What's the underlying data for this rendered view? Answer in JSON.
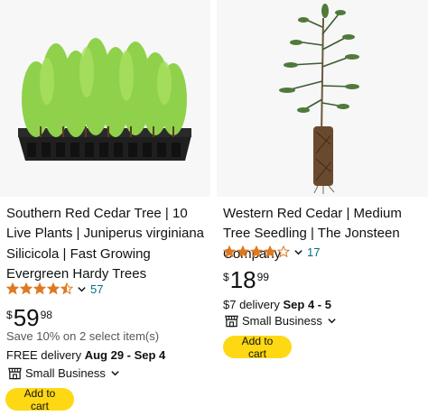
{
  "products": [
    {
      "title": "Southern Red Cedar Tree | 10 Live Plants | Juniperus virginiana Silicicola | Fast Growing Evergreen Hardy Trees",
      "rating": 4.5,
      "review_count": "57",
      "price_symbol": "$",
      "price_whole": "59",
      "price_fraction": "98",
      "promo": "Save 10% on 2 select item(s)",
      "delivery_prefix": "FREE delivery ",
      "delivery_dates": "Aug 29 - Sep 4",
      "badge": "Small Business",
      "button": "Add to cart"
    },
    {
      "title": "Western Red Cedar | Medium Tree Seedling | The Jonsteen Company",
      "rating": 4.0,
      "review_count": "17",
      "price_symbol": "$",
      "price_whole": "18",
      "price_fraction": "99",
      "delivery_prefix": "$7 delivery ",
      "delivery_dates": "Sep 4 - 5",
      "badge": "Small Business",
      "button": "Add to cart"
    }
  ],
  "colors": {
    "star": "#de7921",
    "link": "#007185",
    "button": "#ffd814",
    "text": "#0f1111",
    "muted": "#565959"
  },
  "icons": {
    "rating_dropdown": "chevron-down-icon",
    "badge": "small-business-icon"
  }
}
